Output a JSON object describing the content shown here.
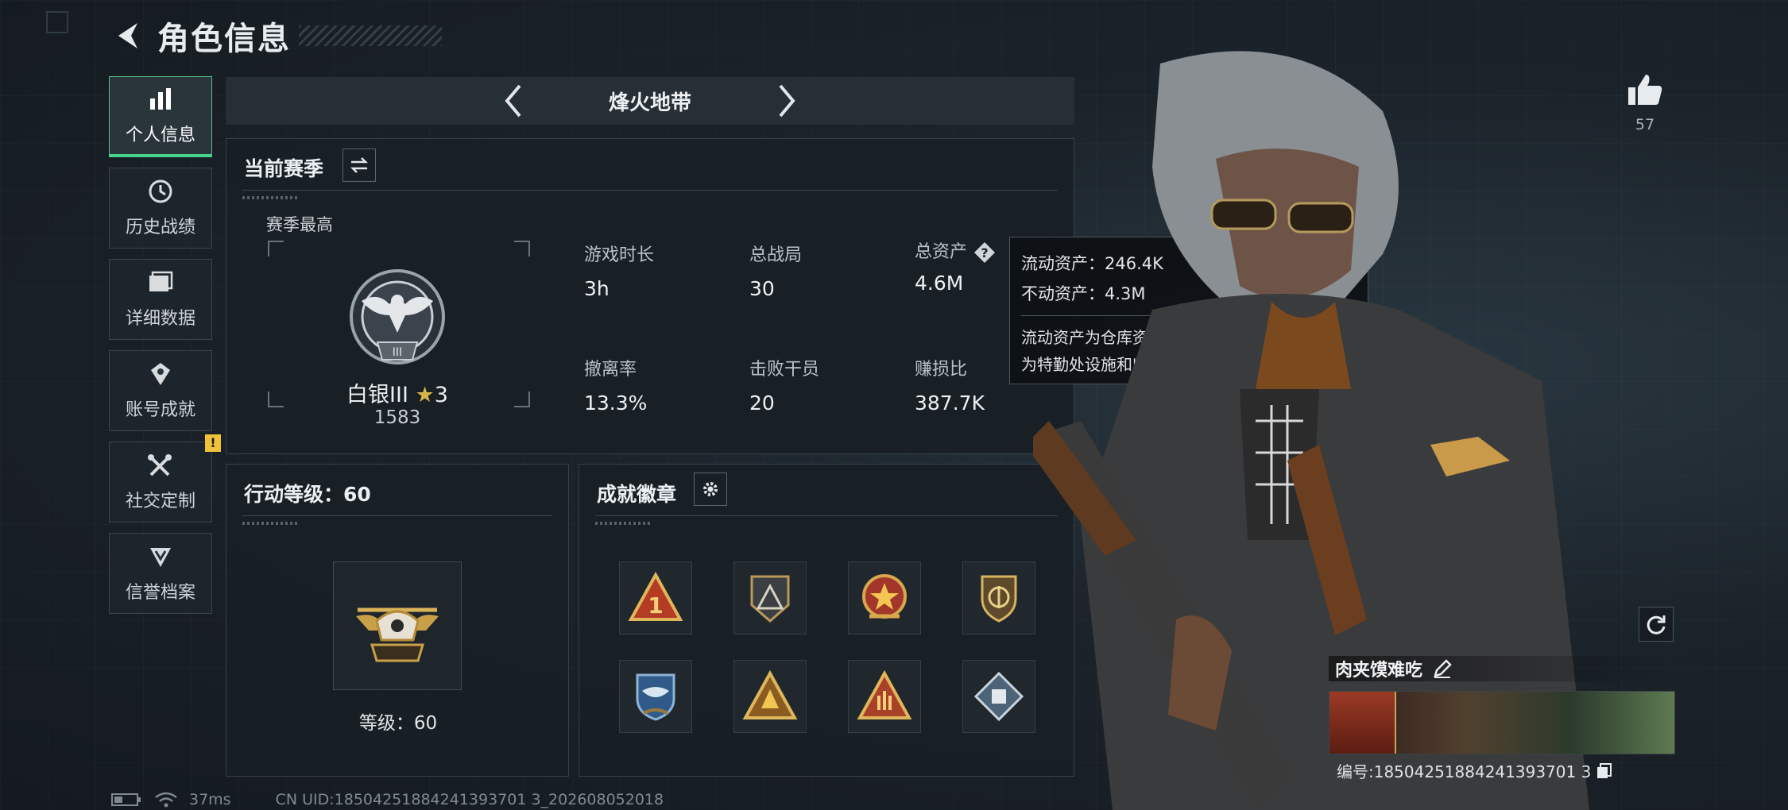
{
  "header": {
    "title": "角色信息"
  },
  "sidebar": {
    "items": [
      {
        "label": "个人信息",
        "icon": "bar-chart-icon",
        "active": true
      },
      {
        "label": "历史战绩",
        "icon": "history-icon"
      },
      {
        "label": "详细数据",
        "icon": "folder-icon"
      },
      {
        "label": "账号成就",
        "icon": "achievement-icon"
      },
      {
        "label": "社交定制",
        "icon": "tools-icon",
        "badge": "!"
      },
      {
        "label": "信誉档案",
        "icon": "credit-icon"
      }
    ]
  },
  "mode": {
    "name": "烽火地带"
  },
  "season": {
    "title": "当前赛季",
    "best_label": "赛季最高",
    "rank_name": "白银III",
    "rank_stars": "3",
    "rank_score": "1583",
    "stats": [
      {
        "label": "游戏时长",
        "value": "3h"
      },
      {
        "label": "总战局",
        "value": "30"
      },
      {
        "label": "总资产",
        "value": "4.6M"
      },
      {
        "label": "撤离率",
        "value": "13.3%"
      },
      {
        "label": "击败干员",
        "value": "20"
      },
      {
        "label": "赚损比",
        "value": "387.7K"
      }
    ]
  },
  "tooltip": {
    "liquid": "流动资产：246.4K",
    "fixed": "不动资产：4.3M",
    "desc_line1": "流动资产为仓库资产和哈夫币，不动资产",
    "desc_line2": "为特勤处设施和收藏室设施"
  },
  "level_panel": {
    "title": "行动等级：60",
    "level_text": "等级：60"
  },
  "badges_panel": {
    "title": "成就徽章",
    "badges": [
      "badge-1-triangle",
      "badge-dark-triangle",
      "badge-star-seal",
      "badge-shield",
      "badge-blue-wings",
      "badge-gold-triangle",
      "badge-hand-sign",
      "badge-diamond-fist"
    ]
  },
  "likes": {
    "count": "57"
  },
  "player": {
    "name": "肉夹馍难吃",
    "id_line": "编号:18504251884241393701 3"
  },
  "footer": {
    "ping": "37ms",
    "uid": "CN UID:18504251884241393701 3_202608052018"
  },
  "colors": {
    "accent_green": "#47d28f",
    "warning_yellow": "#f0c23a",
    "gold": "#c9a04a"
  }
}
